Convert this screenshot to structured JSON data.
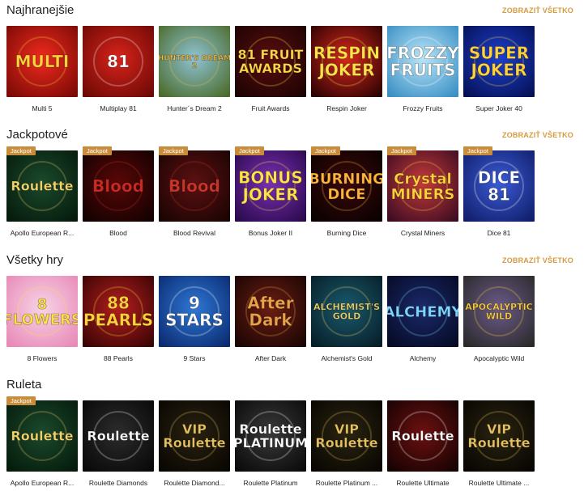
{
  "sections": [
    {
      "title": "Najhranejšie",
      "link": "ZOBRAZIŤ VŠETKO",
      "games": [
        {
          "title": "Multi 5",
          "art": "MULTI",
          "jackpot": false,
          "bg1": "#f02a1e",
          "bg2": "#7a0a05",
          "fg": "#ffd23c"
        },
        {
          "title": "Multiplay 81",
          "art": "81",
          "jackpot": false,
          "bg1": "#d8231b",
          "bg2": "#6d0905",
          "fg": "#ffffff"
        },
        {
          "title": "Hunter´s Dream 2",
          "art": "HUNTER'S DREAM 2",
          "jackpot": false,
          "bg1": "#8fc3d4",
          "bg2": "#4b6b2a",
          "fg": "#f3c14a"
        },
        {
          "title": "Fruit Awards",
          "art": "81 FRUIT AWARDS",
          "jackpot": false,
          "bg1": "#5b0d0d",
          "bg2": "#1c0303",
          "fg": "#ffd84a"
        },
        {
          "title": "Respin Joker",
          "art": "RESPIN JOKER",
          "jackpot": false,
          "bg1": "#d9261b",
          "bg2": "#2a0303",
          "fg": "#ffe14a"
        },
        {
          "title": "Frozzy Fruits",
          "art": "FROZZY FRUITS",
          "jackpot": false,
          "bg1": "#b8e6f8",
          "bg2": "#3a8fc4",
          "fg": "#ffffff"
        },
        {
          "title": "Super Joker 40",
          "art": "SUPER JOKER",
          "jackpot": false,
          "bg1": "#1c3fd0",
          "bg2": "#061154",
          "fg": "#ffd23c"
        }
      ]
    },
    {
      "title": "Jackpotové",
      "link": "ZOBRAZIŤ VŠETKO",
      "games": [
        {
          "title": "Apollo European R...",
          "art": "Roulette",
          "jackpot": true,
          "jackpot_label": "Jackpot",
          "bg1": "#1b4a2c",
          "bg2": "#051a0c",
          "fg": "#f3d36a"
        },
        {
          "title": "Blood",
          "art": "Blood",
          "jackpot": true,
          "jackpot_label": "Jackpot",
          "bg1": "#5a0707",
          "bg2": "#120101",
          "fg": "#c92a22"
        },
        {
          "title": "Blood Revival",
          "art": "Blood",
          "jackpot": true,
          "jackpot_label": "Jackpot",
          "bg1": "#5d1010",
          "bg2": "#1a0404",
          "fg": "#c7352b"
        },
        {
          "title": "Bonus Joker II",
          "art": "BONUS JOKER",
          "jackpot": true,
          "jackpot_label": "Jackpot",
          "bg1": "#7b2fb5",
          "bg2": "#2a0a4c",
          "fg": "#ffe14a"
        },
        {
          "title": "Burning Dice",
          "art": "BURNING DICE",
          "jackpot": true,
          "jackpot_label": "Jackpot",
          "bg1": "#3a0808",
          "bg2": "#0a0101",
          "fg": "#ffb53a"
        },
        {
          "title": "Crystal Miners",
          "art": "Crystal MINERS",
          "jackpot": true,
          "jackpot_label": "Jackpot",
          "bg1": "#c63a3a",
          "bg2": "#3c0c22",
          "fg": "#ffd23c"
        },
        {
          "title": "Dice 81",
          "art": "DICE 81",
          "jackpot": true,
          "jackpot_label": "Jackpot",
          "bg1": "#3b5bd6",
          "bg2": "#101e6a",
          "fg": "#ffffff"
        }
      ]
    },
    {
      "title": "Všetky hry",
      "link": "ZOBRAZIŤ VŠETKO",
      "games": [
        {
          "title": "8 Flowers",
          "art": "8 FLOWERS",
          "jackpot": false,
          "bg1": "#f7d3e6",
          "bg2": "#e889b7",
          "fg": "#ffe14a"
        },
        {
          "title": "88 Pearls",
          "art": "88 PEARLS",
          "jackpot": false,
          "bg1": "#b51e1e",
          "bg2": "#3a0404",
          "fg": "#ffd23c"
        },
        {
          "title": "9 Stars",
          "art": "9 STARS",
          "jackpot": false,
          "bg1": "#2e78d6",
          "bg2": "#0b2a70",
          "fg": "#ffffff"
        },
        {
          "title": "After Dark",
          "art": "After Dark",
          "jackpot": false,
          "bg1": "#6b1d12",
          "bg2": "#1a0503",
          "fg": "#e8a34a"
        },
        {
          "title": "Alchemist's Gold",
          "art": "ALCHEMIST'S GOLD",
          "jackpot": false,
          "bg1": "#1a5a6c",
          "bg2": "#071e28",
          "fg": "#f3d36a"
        },
        {
          "title": "Alchemy",
          "art": "ALCHEMY",
          "jackpot": false,
          "bg1": "#1a2a6a",
          "bg2": "#060a24",
          "fg": "#7fd4ff"
        },
        {
          "title": "Apocalyptic Wild",
          "art": "APOCALYPTIC WILD",
          "jackpot": false,
          "bg1": "#6c5a8a",
          "bg2": "#2a2a2a",
          "fg": "#ffd23c"
        }
      ]
    },
    {
      "title": "Ruleta",
      "link": "",
      "games": [
        {
          "title": "Apollo European R...",
          "art": "Roulette",
          "jackpot": true,
          "jackpot_label": "Jackpot",
          "bg1": "#1b4a2c",
          "bg2": "#051a0c",
          "fg": "#f3d36a"
        },
        {
          "title": "Roulette Diamonds",
          "art": "Roulette",
          "jackpot": false,
          "bg1": "#2c2c2c",
          "bg2": "#080808",
          "fg": "#ffffff"
        },
        {
          "title": "Roulette Diamond...",
          "art": "VIP Roulette",
          "jackpot": false,
          "bg1": "#2a2210",
          "bg2": "#080602",
          "fg": "#e6c260"
        },
        {
          "title": "Roulette Platinum",
          "art": "Roulette PLATINUM",
          "jackpot": false,
          "bg1": "#3a3a3a",
          "bg2": "#0a0a0a",
          "fg": "#ffffff"
        },
        {
          "title": "Roulette Platinum ...",
          "art": "VIP Roulette",
          "jackpot": false,
          "bg1": "#2a2410",
          "bg2": "#080602",
          "fg": "#e6c260"
        },
        {
          "title": "Roulette Ultimate",
          "art": "Roulette",
          "jackpot": false,
          "bg1": "#6e1010",
          "bg2": "#150202",
          "fg": "#ffffff"
        },
        {
          "title": "Roulette Ultimate ...",
          "art": "VIP Roulette",
          "jackpot": false,
          "bg1": "#2a2410",
          "bg2": "#070502",
          "fg": "#e6c260"
        }
      ]
    }
  ]
}
